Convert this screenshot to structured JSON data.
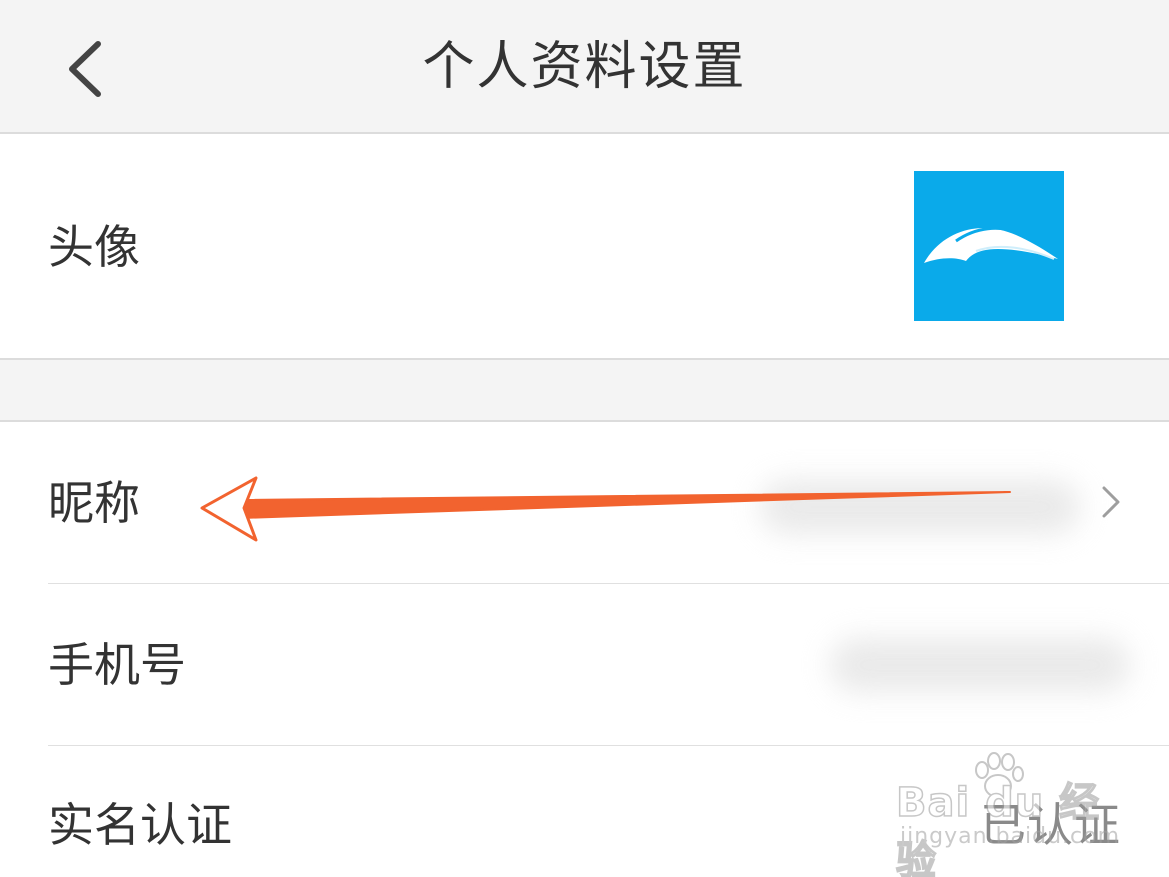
{
  "header": {
    "title": "个人资料设置",
    "back_icon": "chevron-left-icon"
  },
  "profile": {
    "avatar": {
      "label": "头像",
      "avatar_color": "#0aaaea"
    },
    "nickname": {
      "label": "昵称",
      "value_obscured": true
    },
    "phone": {
      "label": "手机号",
      "value_obscured": true
    },
    "real_name": {
      "label": "实名认证",
      "status": "已认证"
    }
  },
  "annotation": {
    "arrow_color": "#f2632f",
    "points_to": "昵称"
  },
  "watermark": {
    "brand": "Bai du 经验",
    "url": "jingyan.baidu.com"
  },
  "colors": {
    "header_bg": "#f4f4f4",
    "text": "#333333",
    "muted": "#8a8a8a",
    "divider": "#e0e0e0"
  }
}
